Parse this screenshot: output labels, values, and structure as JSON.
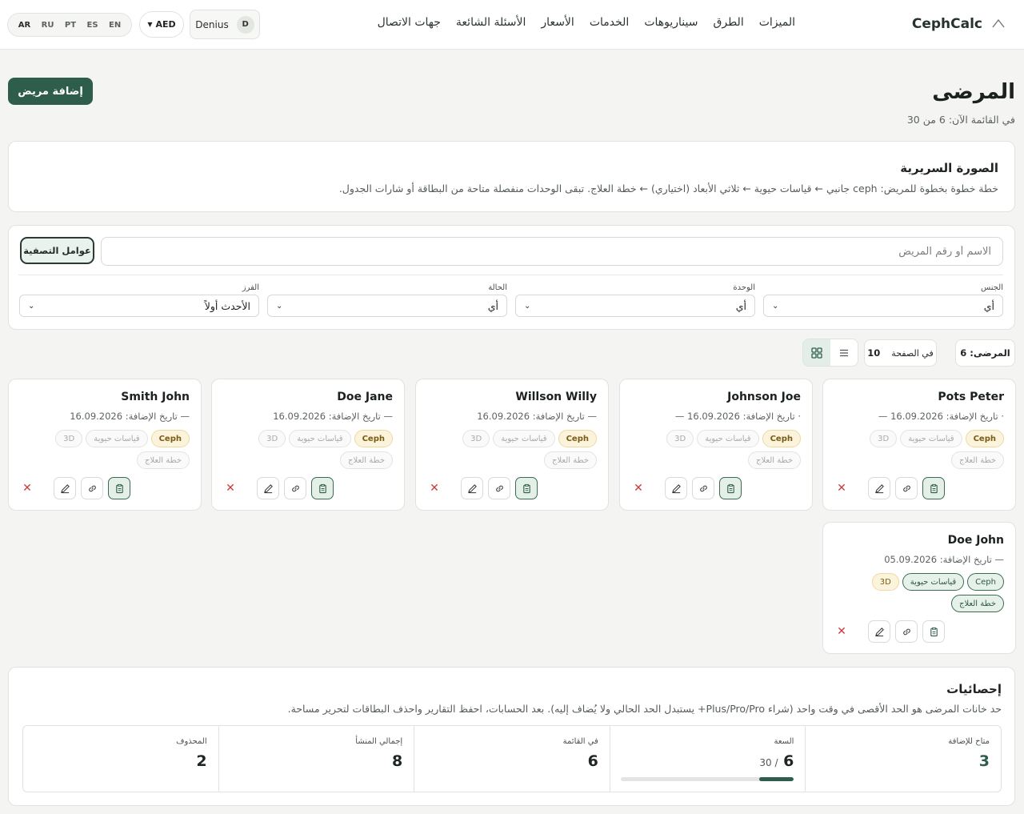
{
  "brand": {
    "name": "CephCalc"
  },
  "nav": [
    "الميزات",
    "الطرق",
    "سيناريوهات",
    "الخدمات",
    "الأسعار",
    "الأسئلة الشائعة",
    "جهات الاتصال"
  ],
  "languages": [
    "EN",
    "ES",
    "PT",
    "RU",
    "AR"
  ],
  "currency": {
    "label": "AED"
  },
  "user": {
    "name": "Denius",
    "initial": "D"
  },
  "page": {
    "title": "المرضى",
    "subtitle": "في القائمة الآن: 6 من 30",
    "add_button": "إضافة مريض"
  },
  "quick_view": {
    "title": "الصورة السريرية",
    "description": "خطة خطوة بخطوة للمريض: ceph جانبي ← قياسات حيوية ← ثلاثي الأبعاد (اختياري) ← خطة العلاج. تبقى الوحدات منفصلة متاحة من البطاقة أو شارات الجدول."
  },
  "filters": {
    "search_placeholder": "الاسم أو رقم المريض",
    "filter_button": "عوامل التصفية",
    "gender": {
      "label": "الجنس",
      "value": "أي"
    },
    "module": {
      "label": "الوحدة",
      "value": "أي"
    },
    "status": {
      "label": "الحالة",
      "value": "أي"
    },
    "sort": {
      "label": "الفرز",
      "value": "الأحدث أولاً"
    }
  },
  "toolbar": {
    "count_label": "المرضى: 6",
    "per_page_label": "في الصفحة",
    "per_page_value": "10"
  },
  "module_labels": {
    "ceph": "Ceph",
    "bio": "قياسات حيوية",
    "three_d": "3D",
    "plan": "خطة العلاج"
  },
  "patients": [
    {
      "name": "Pots Peter",
      "date": "· تاريخ الإضافة: 16.09.2026 —"
    },
    {
      "name": "Johnson Joe",
      "date": "· تاريخ الإضافة: 16.09.2026 —"
    },
    {
      "name": "Willson Willy",
      "date": "— تاريخ الإضافة: 16.09.2026"
    },
    {
      "name": "Doe Jane",
      "date": "— تاريخ الإضافة: 16.09.2026"
    },
    {
      "name": "Smith John",
      "date": "— تاريخ الإضافة: 16.09.2026"
    },
    {
      "name": "Doe John",
      "date": "— تاريخ الإضافة: 05.09.2026"
    }
  ],
  "stats": {
    "title": "إحصائيات",
    "description": "حد خانات المرضى هو الحد الأقصى في وقت واحد (شراء Plus/Pro/Pro+ يستبدل الحد الحالي ولا يُضاف إليه). بعد الحسابات، احفظ التقارير واحذف البطاقات لتحرير مساحة.",
    "available": {
      "label": "متاح للإضافة",
      "value": "3"
    },
    "capacity": {
      "label": "السعة",
      "value": "6",
      "total": "/ 30",
      "fill_fraction": 0.2
    },
    "in_list": {
      "label": "في القائمة",
      "value": "6"
    },
    "total_created": {
      "label": "إجمالي المنشأ",
      "value": "8"
    },
    "deleted": {
      "label": "المحذوف",
      "value": "2"
    }
  },
  "colors": {
    "accent": "#2e5e4b",
    "ceph_chip": "#fbf3dc",
    "danger": "#cc3a3a"
  }
}
